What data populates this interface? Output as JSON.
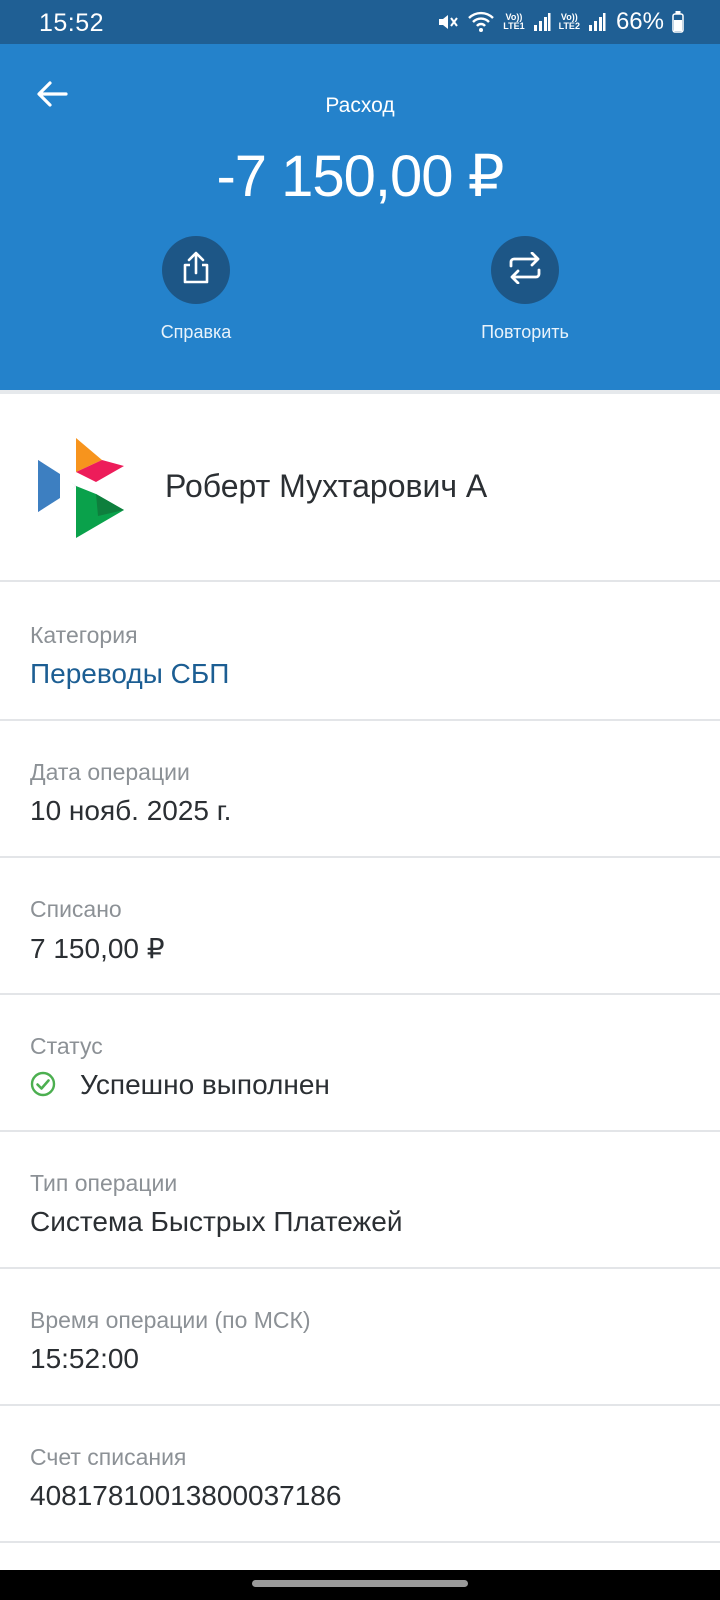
{
  "status_bar": {
    "time": "15:52",
    "sim1_top": "Vo))",
    "sim1_bottom": "LTE1",
    "sim2_top": "Vo))",
    "sim2_bottom": "LTE2",
    "battery": "66%"
  },
  "header": {
    "title": "Расход",
    "amount": "-7 150,00 ₽",
    "actions": [
      {
        "label": "Справка",
        "icon": "share-icon"
      },
      {
        "label": "Повторить",
        "icon": "repeat-icon"
      }
    ]
  },
  "recipient": {
    "name": "Роберт Мухтарович А",
    "logo": "sbp-logo"
  },
  "details": [
    {
      "label": "Категория",
      "value": "Переводы СБП"
    },
    {
      "label": "Дата операции",
      "value": "10 нояб. 2025 г."
    },
    {
      "label": "Списано",
      "value": "7 150,00 ₽"
    },
    {
      "label": "Статус",
      "value": "Успешно выполнен",
      "icon": "check-circle-icon"
    },
    {
      "label": "Тип операции",
      "value": "Система Быстрых Платежей"
    },
    {
      "label": "Время операции (по МСК)",
      "value": "15:52:00"
    },
    {
      "label": "Счет списания",
      "value": "40817810013800037186"
    }
  ],
  "colors": {
    "header_bg": "#2482cb",
    "status_bar_bg": "#1f5f94",
    "action_circle": "#1d5686",
    "link": "#1c5e93",
    "success": "#4caf50"
  }
}
